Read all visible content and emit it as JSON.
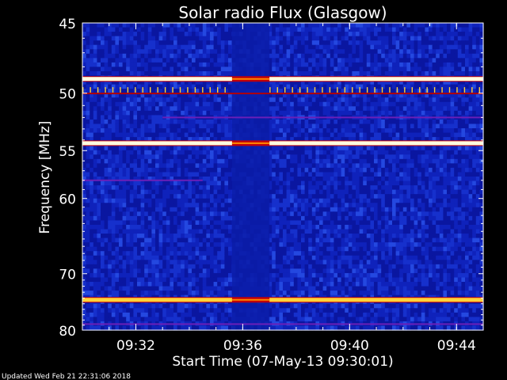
{
  "chart_data": {
    "type": "heatmap",
    "title": "Solar radio Flux (Glasgow)",
    "xlabel": "Start Time (07-May-13 09:30:01)",
    "ylabel": "Frequency [MHz]",
    "y_axis": {
      "range": [
        45,
        80
      ],
      "inverted": true,
      "ticks": [
        45,
        50,
        55,
        60,
        70,
        80
      ]
    },
    "x_axis": {
      "range_minutes": [
        0,
        15
      ],
      "ticks": [
        "09:32",
        "09:36",
        "09:40",
        "09:44"
      ],
      "tick_minutes": [
        2,
        6,
        10,
        14
      ]
    },
    "colormap": [
      "#00003a",
      "#1433c8",
      "#3b78ff",
      "#c0000a",
      "#ff6a00",
      "#ffd23a",
      "#ffffe0"
    ],
    "features": [
      {
        "name": "continuous band",
        "freq_mhz": 48.9,
        "start_min": 0,
        "end_min": 15,
        "intensity": 0.93
      },
      {
        "name": "continuous band",
        "freq_mhz": 54.3,
        "start_min": 0,
        "end_min": 15,
        "intensity": 0.95
      },
      {
        "name": "continuous band",
        "freq_mhz": 74.3,
        "start_min": 0,
        "end_min": 15,
        "intensity": 0.9
      },
      {
        "name": "intermittent spikes",
        "freq_mhz": 49.9,
        "start_min": 0,
        "end_min": 15,
        "intensity": 0.8
      },
      {
        "name": "weak band",
        "freq_mhz": 52.0,
        "start_min": 3,
        "end_min": 15,
        "intensity": 0.55
      },
      {
        "name": "weak band",
        "freq_mhz": 58.0,
        "start_min": 0,
        "end_min": 4.5,
        "intensity": 0.5
      },
      {
        "name": "weak band",
        "freq_mhz": 78.8,
        "start_min": 0,
        "end_min": 15,
        "intensity": 0.5
      }
    ],
    "gap_minutes": [
      5.6,
      7.0
    ]
  },
  "footer": {
    "updated": "Updated Wed Feb 21 22:31:06 2018"
  }
}
